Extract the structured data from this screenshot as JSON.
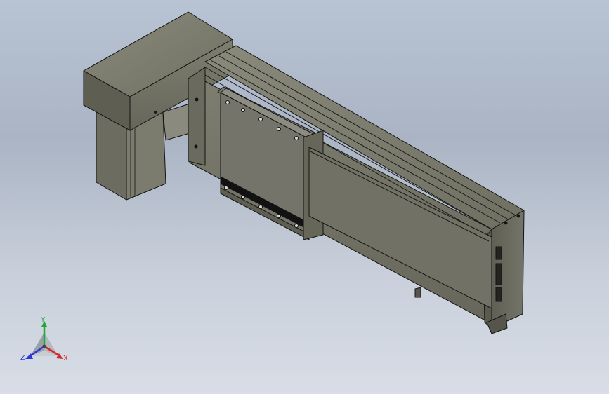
{
  "viewport": {
    "background": "#b3bdcc"
  },
  "triad": {
    "y_label": "Y",
    "x_label": "X",
    "z_label": "Z",
    "colors": {
      "y": "#1fa83a",
      "x": "#d32a2a",
      "z": "#2a3ad3"
    }
  },
  "model": {
    "icon": "linear-actuator-model",
    "body_color": "#77776a",
    "edge_color": "#141414",
    "slot_color": "#121212"
  }
}
